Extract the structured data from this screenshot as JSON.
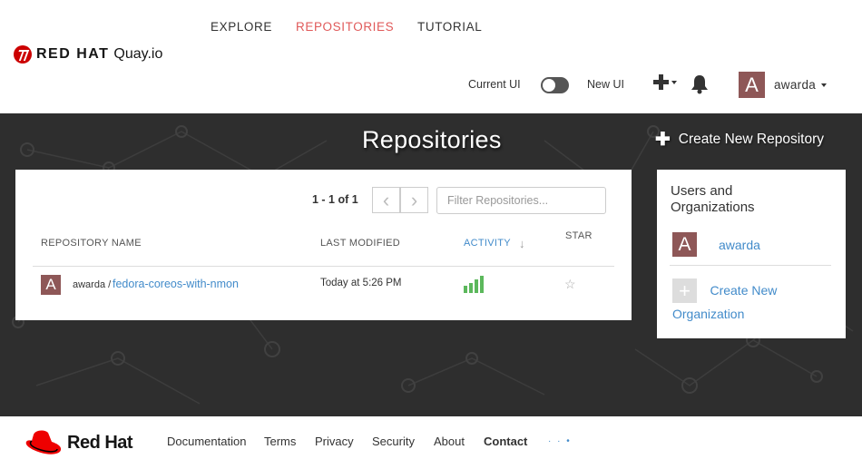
{
  "nav": {
    "explore": "EXPLORE",
    "repositories": "REPOSITORIES",
    "tutorial": "TUTORIAL"
  },
  "logo": {
    "brand": "RED HAT",
    "product": "Quay.io"
  },
  "ui_toggle": {
    "current": "Current UI",
    "new": "New UI",
    "state": "off"
  },
  "user": {
    "initial": "A",
    "name": "awarda"
  },
  "hero": {
    "title": "Repositories",
    "create_repo": "Create New Repository"
  },
  "repos": {
    "paging": "1 - 1 of 1",
    "prev": "‹",
    "next": "›",
    "filter_placeholder": "Filter Repositories...",
    "headers": {
      "name": "REPOSITORY NAME",
      "modified": "LAST MODIFIED",
      "activity": "ACTIVITY",
      "star": "STAR"
    },
    "rows": [
      {
        "initial": "A",
        "namespace": "awarda /",
        "name": "fedora-coreos-with-nmon",
        "modified": "Today at 5:26 PM",
        "activity_levels": [
          0.4,
          0.6,
          0.8,
          1.0
        ]
      }
    ]
  },
  "orgs": {
    "heading": "Users and Organizations",
    "user_initial": "A",
    "user_name": "awarda",
    "create": "Create New Organization"
  },
  "footer": {
    "logo": "Red Hat",
    "links": [
      "Documentation",
      "Terms",
      "Privacy",
      "Security",
      "About",
      "Contact"
    ],
    "dots": "· · •"
  },
  "colors": {
    "accent": "#e05a5a",
    "link": "#428bca",
    "avatar": "#8e5757",
    "activity": "#5cb85c",
    "hero_bg": "#2e2e2e",
    "redhat": "#cc0000"
  }
}
